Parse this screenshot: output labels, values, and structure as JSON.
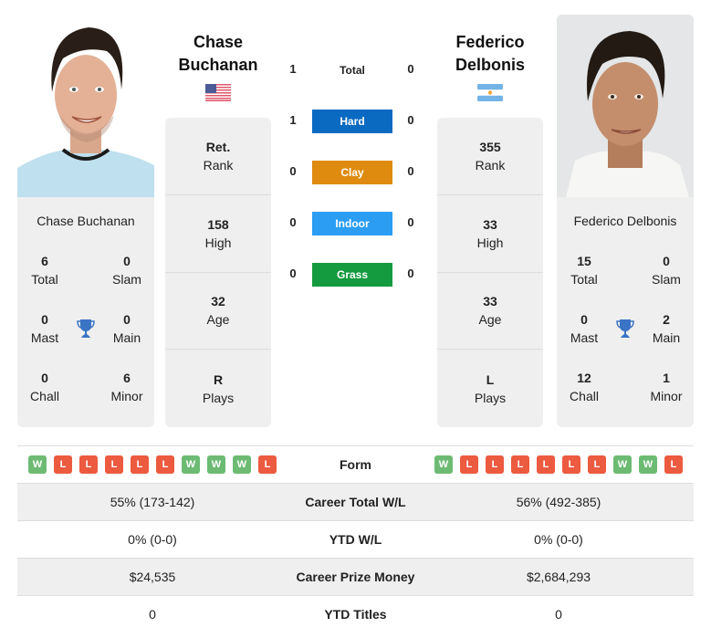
{
  "colors": {
    "hard": "#0a6ac2",
    "clay": "#de8b0f",
    "indoor": "#2b9df3",
    "grass": "#149a3f",
    "win": "#6dbb73",
    "loss": "#ec5a3f",
    "trophy": "#3a74c4"
  },
  "player1": {
    "name_line1": "Chase",
    "name_line2": "Buchanan",
    "full_name": "Chase Buchanan",
    "flag": "USA",
    "photo": "player-photo",
    "rank": {
      "value": "Ret.",
      "label": "Rank"
    },
    "high": {
      "value": "158",
      "label": "High"
    },
    "age": {
      "value": "32",
      "label": "Age"
    },
    "plays": {
      "value": "R",
      "label": "Plays"
    },
    "titles": {
      "total": {
        "value": "6",
        "label": "Total"
      },
      "slam": {
        "value": "0",
        "label": "Slam"
      },
      "mast": {
        "value": "0",
        "label": "Mast"
      },
      "main": {
        "value": "0",
        "label": "Main"
      },
      "chall": {
        "value": "0",
        "label": "Chall"
      },
      "minor": {
        "value": "6",
        "label": "Minor"
      }
    },
    "form": [
      "W",
      "L",
      "L",
      "L",
      "L",
      "L",
      "W",
      "W",
      "W",
      "L"
    ],
    "career_wl": "55% (173-142)",
    "ytd_wl": "0% (0-0)",
    "prize_money": "$24,535",
    "ytd_titles": "0"
  },
  "player2": {
    "name_line1": "Federico",
    "name_line2": "Delbonis",
    "full_name": "Federico Delbonis",
    "flag": "Argentina",
    "photo": "player-photo",
    "rank": {
      "value": "355",
      "label": "Rank"
    },
    "high": {
      "value": "33",
      "label": "High"
    },
    "age": {
      "value": "33",
      "label": "Age"
    },
    "plays": {
      "value": "L",
      "label": "Plays"
    },
    "titles": {
      "total": {
        "value": "15",
        "label": "Total"
      },
      "slam": {
        "value": "0",
        "label": "Slam"
      },
      "mast": {
        "value": "0",
        "label": "Mast"
      },
      "main": {
        "value": "2",
        "label": "Main"
      },
      "chall": {
        "value": "12",
        "label": "Chall"
      },
      "minor": {
        "value": "1",
        "label": "Minor"
      }
    },
    "form": [
      "W",
      "L",
      "L",
      "L",
      "L",
      "L",
      "L",
      "W",
      "W",
      "L"
    ],
    "career_wl": "56% (492-385)",
    "ytd_wl": "0% (0-0)",
    "prize_money": "$2,684,293",
    "ytd_titles": "0"
  },
  "h2h": [
    {
      "surface": "Total",
      "p1": "1",
      "p2": "0"
    },
    {
      "surface": "Hard",
      "p1": "1",
      "p2": "0"
    },
    {
      "surface": "Clay",
      "p1": "0",
      "p2": "0"
    },
    {
      "surface": "Indoor",
      "p1": "0",
      "p2": "0"
    },
    {
      "surface": "Grass",
      "p1": "0",
      "p2": "0"
    }
  ],
  "table_labels": {
    "form": "Form",
    "career_wl": "Career Total W/L",
    "ytd_wl": "YTD W/L",
    "prize_money": "Career Prize Money",
    "ytd_titles": "YTD Titles"
  }
}
